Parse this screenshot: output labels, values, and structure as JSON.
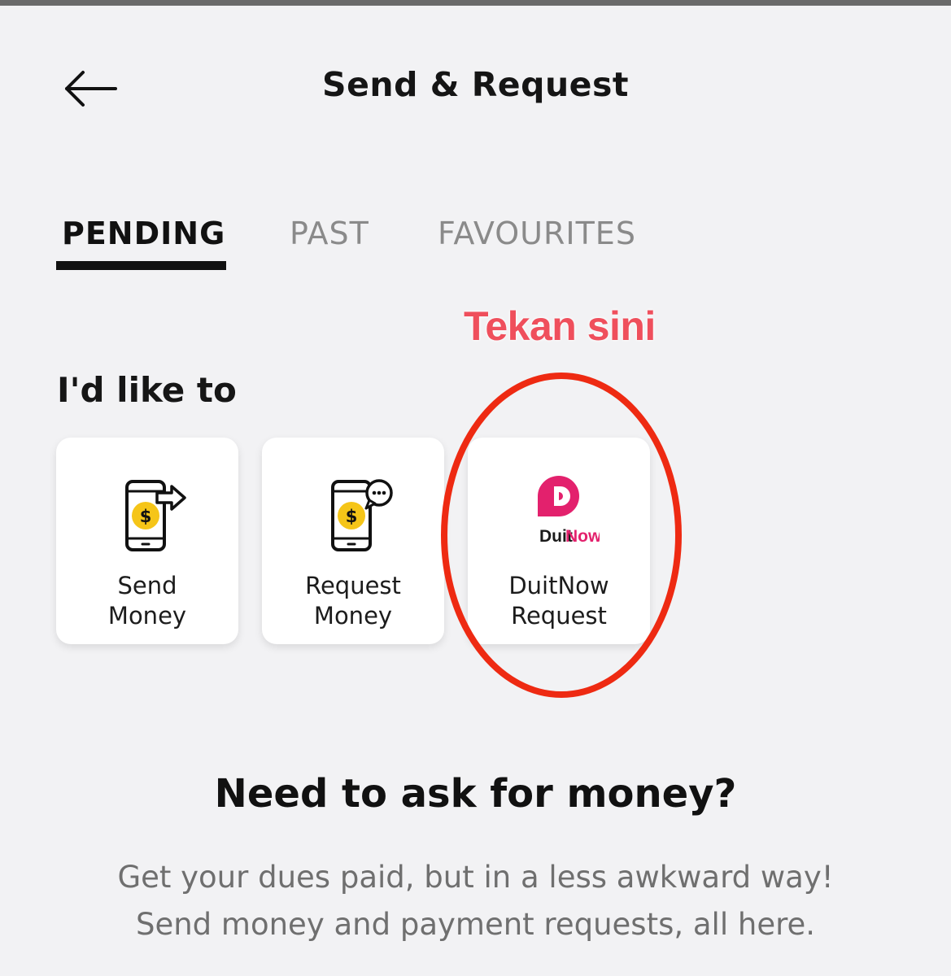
{
  "header": {
    "title": "Send & Request",
    "back_icon": "arrow-left-icon"
  },
  "tabs": [
    {
      "label": "PENDING",
      "active": true
    },
    {
      "label": "PAST",
      "active": false
    },
    {
      "label": "FAVOURITES",
      "active": false
    }
  ],
  "annotation": {
    "text": "Tekan sini",
    "color": "#ef4f5c",
    "highlight_color": "#ee2a12"
  },
  "actions": {
    "heading": "I'd like to",
    "items": [
      {
        "label": "Send\nMoney",
        "icon": "phone-send-money-icon"
      },
      {
        "label": "Request\nMoney",
        "icon": "phone-request-money-icon"
      },
      {
        "label": "DuitNow\nRequest",
        "icon": "duitnow-logo",
        "logo_text_duit": "Duit",
        "logo_text_now": "Now"
      }
    ]
  },
  "promo": {
    "heading": "Need to ask for money?",
    "body": "Get your dues paid, but in a less awkward way!\nSend money and payment requests, all here."
  },
  "colors": {
    "background": "#f2f2f4",
    "coin_yellow": "#f5c518",
    "duitnow_pink": "#e3216d",
    "text_dark": "#111111",
    "text_muted": "#8a8a8a"
  }
}
